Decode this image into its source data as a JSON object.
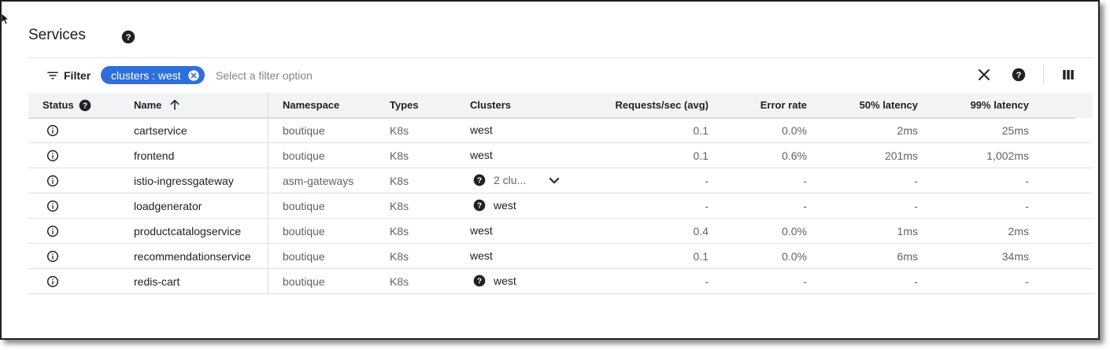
{
  "page": {
    "title": "Services"
  },
  "filter_bar": {
    "filter_label": "Filter",
    "chip_label": "clusters : west",
    "input_value": "",
    "input_placeholder": "Select a filter option"
  },
  "table": {
    "columns": [
      {
        "key": "status",
        "label": "Status"
      },
      {
        "key": "name",
        "label": "Name",
        "sort": "ascending"
      },
      {
        "key": "namespace",
        "label": "Namespace"
      },
      {
        "key": "types",
        "label": "Types"
      },
      {
        "key": "clusters",
        "label": "Clusters"
      },
      {
        "key": "rps",
        "label": "Requests/sec (avg)"
      },
      {
        "key": "error_rate",
        "label": "Error rate"
      },
      {
        "key": "p50",
        "label": "50% latency"
      },
      {
        "key": "p99",
        "label": "99% latency"
      }
    ],
    "rows": [
      {
        "status_icon": "info-icon",
        "name": "cartservice",
        "namespace": "boutique",
        "types": "K8s",
        "clusters": "west",
        "clusters_help": false,
        "expandable": false,
        "rps": "0.1",
        "error_rate": "0.0%",
        "p50": "2ms",
        "p99": "25ms"
      },
      {
        "status_icon": "info-icon",
        "name": "frontend",
        "namespace": "boutique",
        "types": "K8s",
        "clusters": "west",
        "clusters_help": false,
        "expandable": false,
        "rps": "0.1",
        "error_rate": "0.6%",
        "p50": "201ms",
        "p99": "1,002ms"
      },
      {
        "status_icon": "info-icon",
        "name": "istio-ingressgateway",
        "namespace": "asm-gateways",
        "types": "K8s",
        "clusters": "2 clu...",
        "clusters_help": true,
        "expandable": true,
        "rps": "-",
        "error_rate": "-",
        "p50": "-",
        "p99": "-"
      },
      {
        "status_icon": "info-icon",
        "name": "loadgenerator",
        "namespace": "boutique",
        "types": "K8s",
        "clusters": "west",
        "clusters_help": true,
        "expandable": false,
        "rps": "-",
        "error_rate": "-",
        "p50": "-",
        "p99": "-"
      },
      {
        "status_icon": "info-icon",
        "name": "productcatalogservice",
        "namespace": "boutique",
        "types": "K8s",
        "clusters": "west",
        "clusters_help": false,
        "expandable": false,
        "rps": "0.4",
        "error_rate": "0.0%",
        "p50": "1ms",
        "p99": "2ms"
      },
      {
        "status_icon": "info-icon",
        "name": "recommendationservice",
        "namespace": "boutique",
        "types": "K8s",
        "clusters": "west",
        "clusters_help": false,
        "expandable": false,
        "rps": "0.1",
        "error_rate": "0.0%",
        "p50": "6ms",
        "p99": "34ms"
      },
      {
        "status_icon": "info-icon",
        "name": "redis-cart",
        "namespace": "boutique",
        "types": "K8s",
        "clusters": "west",
        "clusters_help": true,
        "expandable": false,
        "rps": "-",
        "error_rate": "-",
        "p50": "-",
        "p99": "-"
      }
    ]
  },
  "colors": {
    "chip_bg": "#2f6fdb",
    "header_bg": "#f1f3f4",
    "text": "#202124",
    "muted_text": "#5f6368"
  }
}
